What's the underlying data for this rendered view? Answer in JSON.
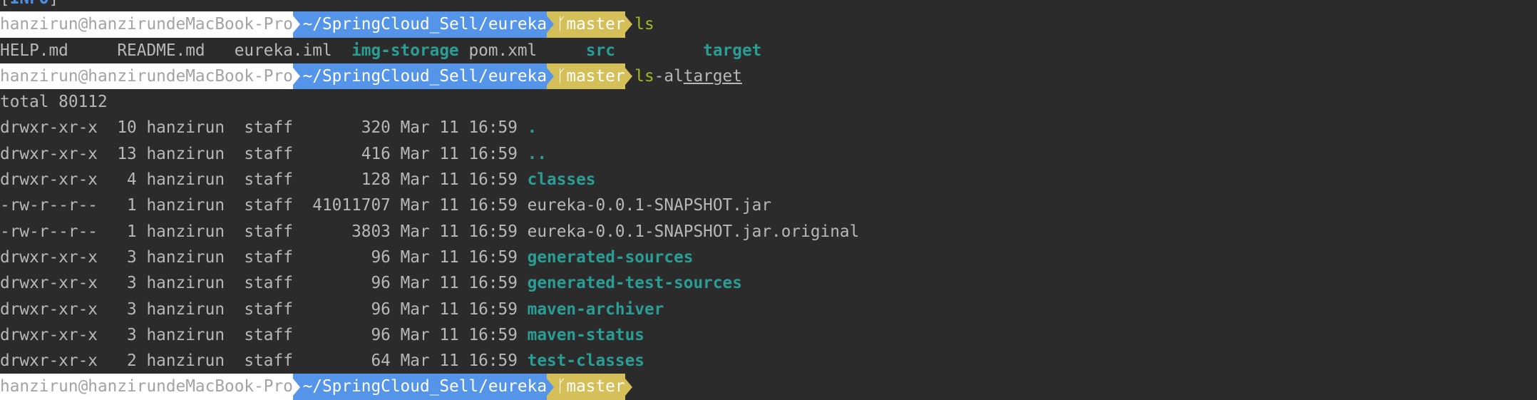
{
  "info_line": {
    "tag": "INFO",
    "rule": "-------------------------------------------------------------------------"
  },
  "prompt": {
    "user_host": "hanzirun@hanzirundeMacBook-Pro",
    "path": "~/SpringCloud_Sell/eureka",
    "branch": "master",
    "branch_icon": "git-branch-icon"
  },
  "commands": [
    {
      "cmd": "ls",
      "args": ""
    },
    {
      "cmd": "ls",
      "args": "-al",
      "target": "target"
    }
  ],
  "ls_output": [
    {
      "name": "HELP.md",
      "dir": false
    },
    {
      "name": "README.md",
      "dir": false
    },
    {
      "name": "eureka.iml",
      "dir": false
    },
    {
      "name": "img-storage",
      "dir": true
    },
    {
      "name": "pom.xml",
      "dir": false
    },
    {
      "name": "src",
      "dir": true
    },
    {
      "name": "target",
      "dir": true
    }
  ],
  "total": "total 80112",
  "ls_al_rows": [
    {
      "meta": "drwxr-xr-x  10 hanzirun  staff       320 Mar 11 16:59 ",
      "name": ".",
      "dir": true
    },
    {
      "meta": "drwxr-xr-x  13 hanzirun  staff       416 Mar 11 16:59 ",
      "name": "..",
      "dir": true
    },
    {
      "meta": "drwxr-xr-x   4 hanzirun  staff       128 Mar 11 16:59 ",
      "name": "classes",
      "dir": true
    },
    {
      "meta": "-rw-r--r--   1 hanzirun  staff  41011707 Mar 11 16:59 ",
      "name": "eureka-0.0.1-SNAPSHOT.jar",
      "dir": false
    },
    {
      "meta": "-rw-r--r--   1 hanzirun  staff      3803 Mar 11 16:59 ",
      "name": "eureka-0.0.1-SNAPSHOT.jar.original",
      "dir": false
    },
    {
      "meta": "drwxr-xr-x   3 hanzirun  staff        96 Mar 11 16:59 ",
      "name": "generated-sources",
      "dir": true
    },
    {
      "meta": "drwxr-xr-x   3 hanzirun  staff        96 Mar 11 16:59 ",
      "name": "generated-test-sources",
      "dir": true
    },
    {
      "meta": "drwxr-xr-x   3 hanzirun  staff        96 Mar 11 16:59 ",
      "name": "maven-archiver",
      "dir": true
    },
    {
      "meta": "drwxr-xr-x   3 hanzirun  staff        96 Mar 11 16:59 ",
      "name": "maven-status",
      "dir": true
    },
    {
      "meta": "drwxr-xr-x   2 hanzirun  staff        64 Mar 11 16:59 ",
      "name": "test-classes",
      "dir": true
    }
  ],
  "colors": {
    "background": "#2b2b2b",
    "text": "#b8b8b8",
    "dir": "#2a9d94",
    "user_seg": "#ffffff",
    "path_seg": "#5595e9",
    "git_seg": "#d5bf58",
    "command": "#a6b820",
    "info": "#4f8fe6"
  }
}
